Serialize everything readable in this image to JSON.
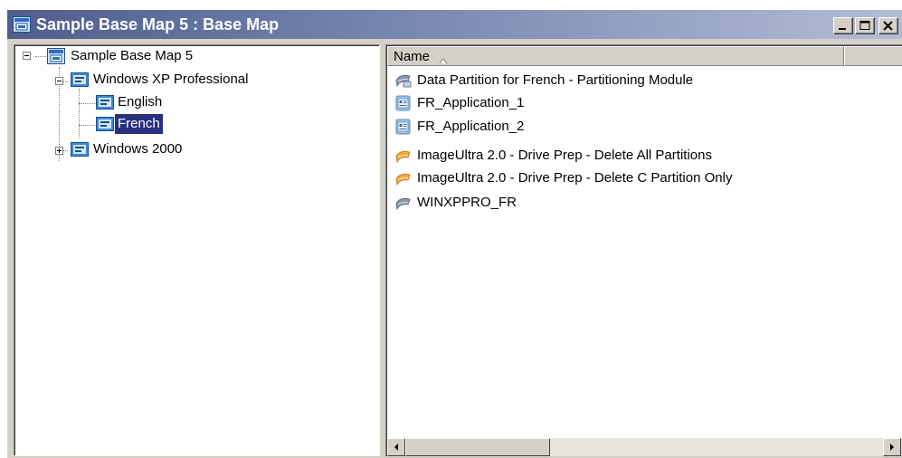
{
  "window": {
    "title": "Sample Base Map 5 : Base Map",
    "controls": [
      "minimize",
      "maximize",
      "close"
    ]
  },
  "tree": {
    "root": {
      "label": "Sample Base Map 5",
      "expanded": true,
      "icon": "base-map-icon"
    },
    "nodes": [
      {
        "label": "Windows XP Professional",
        "expanded": true,
        "icon": "menu-icon"
      },
      {
        "label": "English",
        "icon": "menu-icon"
      },
      {
        "label": "French",
        "icon": "menu-icon",
        "selected": true
      },
      {
        "label": "Windows 2000",
        "expanded": false,
        "icon": "menu-icon"
      }
    ]
  },
  "list": {
    "column_header": "Name",
    "sort": "ascending",
    "items": [
      {
        "label": "Data Partition for French - Partitioning Module",
        "icon": "partition-module-icon"
      },
      {
        "label": "FR_Application_1",
        "icon": "application-module-icon"
      },
      {
        "label": "FR_Application_2",
        "icon": "application-module-icon"
      },
      {
        "label": "ImageUltra 2.0 - Drive Prep - Delete All Partitions",
        "icon": "utility-module-icon"
      },
      {
        "label": "ImageUltra 2.0 - Drive Prep - Delete C Partition Only",
        "icon": "utility-module-icon"
      },
      {
        "label": "WINXPPRO_FR",
        "icon": "os-module-icon"
      }
    ]
  },
  "colors": {
    "title_gradient_start": "#4f5e8c",
    "selection": "#27307f",
    "chrome": "#d4d0c8"
  }
}
